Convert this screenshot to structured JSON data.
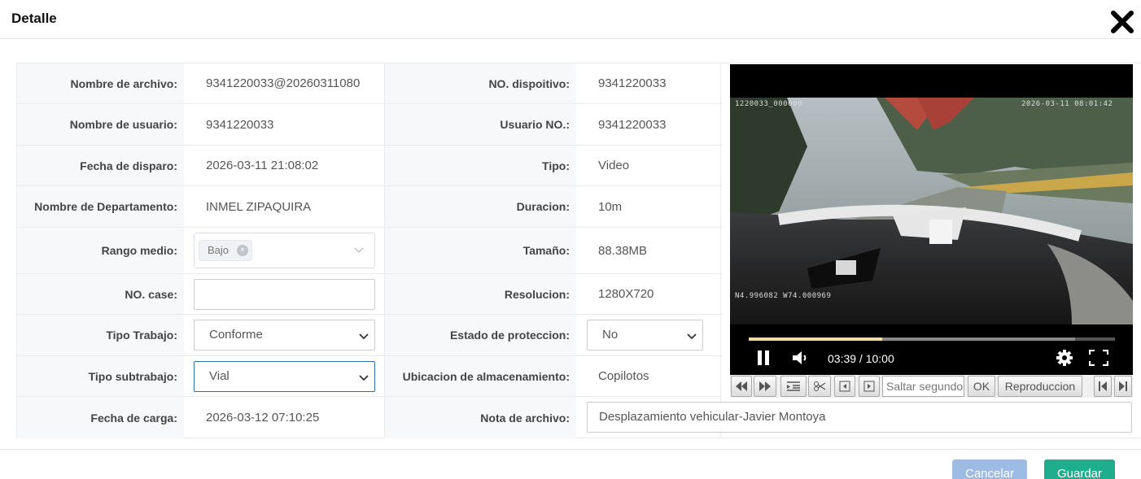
{
  "dialog": {
    "title": "Detalle"
  },
  "fields": {
    "nombre_archivo": {
      "label": "Nombre de archivo",
      "value": "9341220033@20260311080"
    },
    "no_dispositivo": {
      "label": "NO. dispoitivo",
      "value": "9341220033"
    },
    "nombre_usuario": {
      "label": "Nombre de usuario",
      "value": "9341220033"
    },
    "usuario_no": {
      "label": "Usuario NO.",
      "value": "9341220033"
    },
    "fecha_disparo": {
      "label": "Fecha de disparo",
      "value": "2026-03-11 21:08:02"
    },
    "tipo": {
      "label": "Tipo",
      "value": "Video"
    },
    "departamento": {
      "label": "Nombre de Departamento",
      "value": "INMEL ZIPAQUIRA"
    },
    "duracion": {
      "label": "Duracion",
      "value": "10m"
    },
    "rango_medio": {
      "label": "Rango medio",
      "tag": "Bajo"
    },
    "tamano": {
      "label": "Tamaño",
      "value": "88.38MB"
    },
    "no_case": {
      "label": "NO. case",
      "value": ""
    },
    "resolucion": {
      "label": "Resolucion",
      "value": "1280X720"
    },
    "tipo_trabajo": {
      "label": "Tipo Trabajo",
      "value": "Conforme"
    },
    "estado_proteccion": {
      "label": "Estado de proteccion",
      "value": "No"
    },
    "tipo_subtrabajo": {
      "label": "Tipo subtrabajo",
      "value": "Vial"
    },
    "ubicacion": {
      "label": "Ubicacion de almacenamiento",
      "value": "Copilotos"
    },
    "fecha_carga": {
      "label": "Fecha de carga",
      "value": "2026-03-12 07:10:25"
    },
    "nota_archivo": {
      "label": "Nota de archivo",
      "value": "Desplazamiento vehicular-Javier Montoya"
    }
  },
  "video": {
    "osd_device": "1220033_000000",
    "osd_datetime": "2026-03-11  08:01:42",
    "osd_gps": "N4.996082  W74.000969",
    "time_display": "03:39 / 10:00",
    "progress_played": 0.365,
    "progress_buffered": 0.89
  },
  "toolbar": {
    "seek_placeholder": "Saltar segundo",
    "ok_label": "OK",
    "playback_label": "Reproduccion"
  },
  "footer": {
    "cancel_label": "Cancelar",
    "save_label": "Guardar"
  },
  "colors": {
    "save": "#1fae8d",
    "cancel": "#9dbbe3",
    "progress": "#f3dd9c"
  }
}
